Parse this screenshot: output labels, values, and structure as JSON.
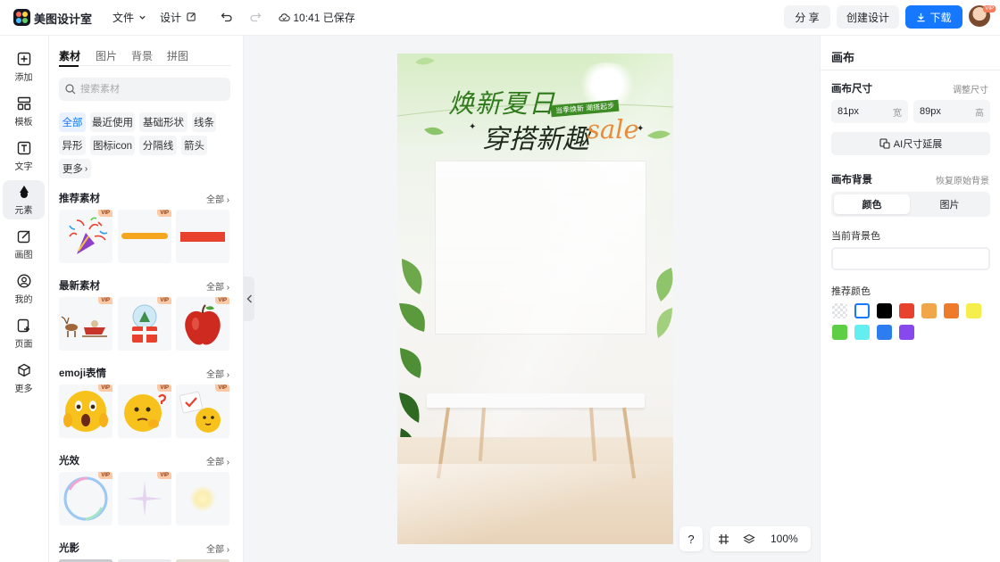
{
  "app": {
    "name": "美图设计室"
  },
  "topbar": {
    "file_menu": "文件",
    "design_menu": "设计",
    "save_status": "10:41 已保存",
    "share_label": "分 享",
    "create_label": "创建设计",
    "download_label": "下载",
    "avatar_badge": "VIP"
  },
  "rail": {
    "items": [
      {
        "label": "添加",
        "icon": "plus-square-icon"
      },
      {
        "label": "模板",
        "icon": "template-icon"
      },
      {
        "label": "文字",
        "icon": "text-icon"
      },
      {
        "label": "元素",
        "icon": "shapes-icon"
      },
      {
        "label": "画图",
        "icon": "draw-icon"
      },
      {
        "label": "我的",
        "icon": "user-icon"
      },
      {
        "label": "页面",
        "icon": "page-icon"
      },
      {
        "label": "更多",
        "icon": "cube-icon"
      }
    ],
    "active": "元素"
  },
  "panel": {
    "tabs": [
      "素材",
      "图片",
      "背景",
      "拼图"
    ],
    "active_tab": "素材",
    "search_placeholder": "搜索素材",
    "chips": [
      "全部",
      "最近使用",
      "基础形状",
      "线条",
      "异形",
      "图标icon",
      "分隔线",
      "箭头",
      "更多"
    ],
    "active_chip": "全部",
    "sections": [
      {
        "title": "推荐素材",
        "all": "全部",
        "thumbs": [
          "party-popper",
          "yellow-brush-stroke",
          "red-rectangle"
        ],
        "vip": [
          true,
          true,
          false
        ]
      },
      {
        "title": "最新素材",
        "all": "全部",
        "thumbs": [
          "reindeer-sleigh",
          "snow-globe",
          "red-apple"
        ],
        "vip": [
          true,
          true,
          true
        ]
      },
      {
        "title": "emoji表情",
        "all": "全部",
        "thumbs": [
          "shocked-emoji",
          "thinking-emoji",
          "sign-emoji"
        ],
        "vip": [
          true,
          true,
          true
        ]
      },
      {
        "title": "光效",
        "all": "全部",
        "thumbs": [
          "bubble-ring",
          "sparkle-light",
          "glow-light"
        ],
        "vip": [
          true,
          true,
          false
        ]
      },
      {
        "title": "光影",
        "all": "全部"
      }
    ],
    "vip_label": "VIP"
  },
  "poster": {
    "title_line1": "焕新夏日",
    "title_line2": "穿搭新趣",
    "sale_text": "sale",
    "tag_text": "当季焕新 潮搭起步"
  },
  "zoom": {
    "help": "?",
    "value": "100%"
  },
  "right_panel": {
    "title": "画布",
    "size_label": "画布尺寸",
    "adjust_size": "调整尺寸",
    "width_value": "81px",
    "width_unit": "宽",
    "height_value": "89px",
    "height_unit": "高",
    "ai_extend": "AI尺寸延展",
    "bg_label": "画布背景",
    "restore_bg": "恢复原始背景",
    "seg_color": "颜色",
    "seg_image": "图片",
    "current_bg_label": "当前背景色",
    "recommended_label": "推荐颜色",
    "swatches": [
      "transparent",
      "#ffffff",
      "#000000",
      "#e8412d",
      "#f2a64a",
      "#ee7a2c",
      "#f6ee4a",
      "#5ecf45",
      "#64eef0",
      "#2d7df0",
      "#8748ee"
    ]
  }
}
